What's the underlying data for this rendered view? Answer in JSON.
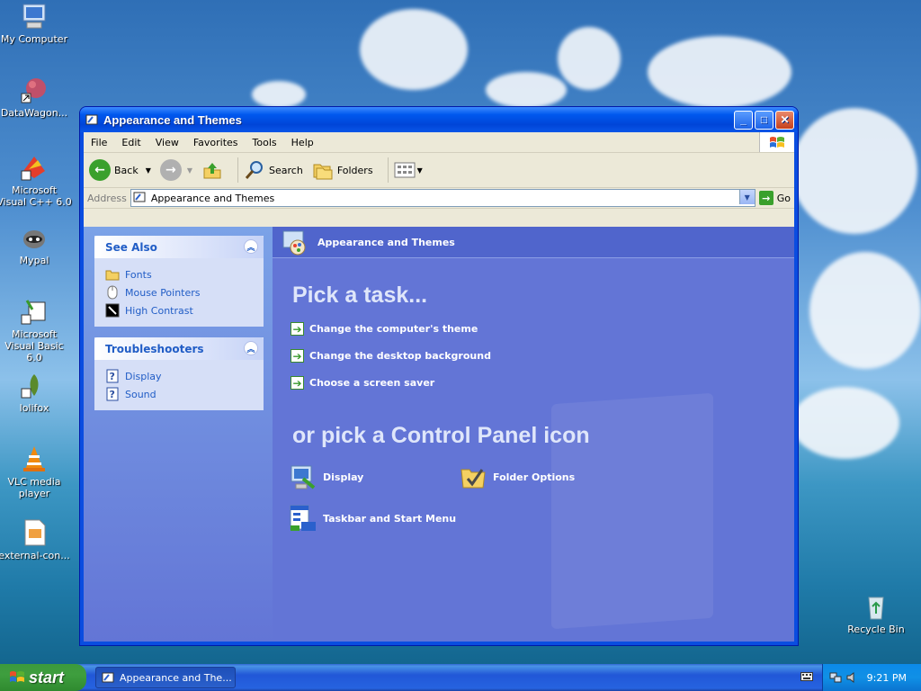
{
  "desktop": {
    "icons": [
      {
        "label": "My Computer"
      },
      {
        "label": "DataWagon..."
      },
      {
        "label": "Microsoft Visual C++ 6.0"
      },
      {
        "label": "Mypal"
      },
      {
        "label": "Microsoft Visual Basic 6.0"
      },
      {
        "label": "lolifox"
      },
      {
        "label": "VLC media player"
      },
      {
        "label": "external-con..."
      },
      {
        "label": "Recycle Bin"
      }
    ]
  },
  "window": {
    "title": "Appearance and Themes",
    "menu": [
      "File",
      "Edit",
      "View",
      "Favorites",
      "Tools",
      "Help"
    ],
    "toolbar": {
      "back": "Back",
      "search": "Search",
      "folders": "Folders"
    },
    "address": {
      "label": "Address",
      "value": "Appearance and Themes",
      "go": "Go"
    }
  },
  "left_pane": {
    "see_also": {
      "title": "See Also",
      "items": [
        "Fonts",
        "Mouse Pointers",
        "High Contrast"
      ]
    },
    "troubleshooters": {
      "title": "Troubleshooters",
      "items": [
        "Display",
        "Sound"
      ]
    }
  },
  "main": {
    "header": "Appearance and Themes",
    "pick_task": "Pick a task...",
    "tasks": [
      "Change the computer's theme",
      "Change the desktop background",
      "Choose a screen saver"
    ],
    "pick_icon": "or pick a Control Panel icon",
    "cp_icons": [
      "Display",
      "Folder Options",
      "Taskbar and Start Menu"
    ]
  },
  "taskbar": {
    "start": "start",
    "button": "Appearance and The...",
    "clock": "9:21 PM"
  }
}
